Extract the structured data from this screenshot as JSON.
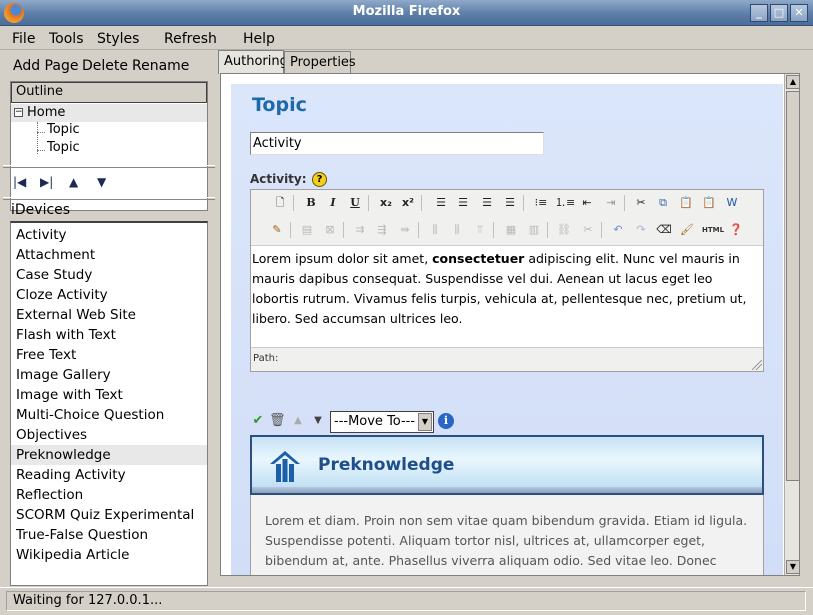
{
  "window": {
    "title": "Mozilla Firefox"
  },
  "menubar": {
    "items": [
      "File",
      "Tools",
      "Styles",
      "Refresh",
      "Help"
    ]
  },
  "outline_toolbar": {
    "add_page": "Add Page",
    "delete": "Delete",
    "rename": "Rename"
  },
  "outline": {
    "header": "Outline",
    "items": [
      {
        "label": "Home",
        "level": 0,
        "expanded": true
      },
      {
        "label": "Topic",
        "level": 1
      },
      {
        "label": "Topic",
        "level": 1
      }
    ]
  },
  "idevices": {
    "label": "iDevices",
    "selected": "Preknowledge",
    "items": [
      "Activity",
      "Attachment",
      "Case Study",
      "Cloze Activity",
      "External Web Site",
      "Flash with Text",
      "Free Text",
      "Image Gallery",
      "Image with Text",
      "Multi-Choice Question",
      "Objectives",
      "Preknowledge",
      "Reading Activity",
      "Reflection",
      "SCORM Quiz Experimental",
      "True-False Question",
      "Wikipedia Article"
    ]
  },
  "tabs": {
    "authoring": "Authoring",
    "properties": "Properties",
    "active": "Authoring"
  },
  "page": {
    "heading": "Topic",
    "title_input_value": "Activity",
    "activity_label": "Activity:",
    "help_glyph": "?",
    "editor": {
      "body_before_bold": "Lorem ipsum dolor sit amet, ",
      "body_bold": "consectetuer",
      "body_after_bold": " adipiscing elit. Nunc vel mauris in mauris dapibus consequat. Suspendisse vel dui. Aenean ut lacus eget leo lobortis rutrum. Vivamus felis turpis, vehicula at, pellentesque nec, pretium ut, libero. Sed accumsan ultrices leo.",
      "path_label": "Path:",
      "toolbar_row1": [
        "new-document-icon",
        "bold-icon",
        "italic-icon",
        "underline-icon",
        "subscript-icon",
        "superscript-icon",
        "align-left-icon",
        "align-center-icon",
        "align-right-icon",
        "align-justify-icon",
        "bullet-list-icon",
        "numbered-list-icon",
        "outdent-icon",
        "indent-icon",
        "cut-icon",
        "copy-icon",
        "paste-icon",
        "paste-text-icon",
        "paste-word-icon"
      ],
      "toolbar_row2": [
        "edit-icon",
        "table-icon",
        "table-delete-icon",
        "row-before-icon",
        "row-after-icon",
        "column-before-icon",
        "column-after-icon",
        "delete-column-icon",
        "merge-cells-icon",
        "split-cells-icon",
        "link-icon",
        "unlink-icon",
        "undo-icon",
        "redo-icon",
        "eraser-icon",
        "cleanup-icon",
        "html-icon",
        "help-icon"
      ],
      "html_label": "HTML"
    },
    "idevice_controls": {
      "move_to": "---Move To---",
      "info_glyph": "i"
    },
    "preknowledge": {
      "title": "Preknowledge",
      "body": "Lorem et diam. Proin non sem vitae quam bibendum gravida. Etiam id ligula. Suspendisse potenti. Aliquam tortor nisl, ultrices at, ullamcorper eget, bibendum at, ante. Phasellus viverra aliquam odio. Sed vitae leo. Donec pulvinar, elit et consequat"
    }
  },
  "status": {
    "text": "Waiting for 127.0.0.1..."
  },
  "colors": {
    "topic_heading": "#1e6aa8",
    "page_background": "#dbe6fb",
    "preknowledge_title": "#1e4e8c"
  }
}
